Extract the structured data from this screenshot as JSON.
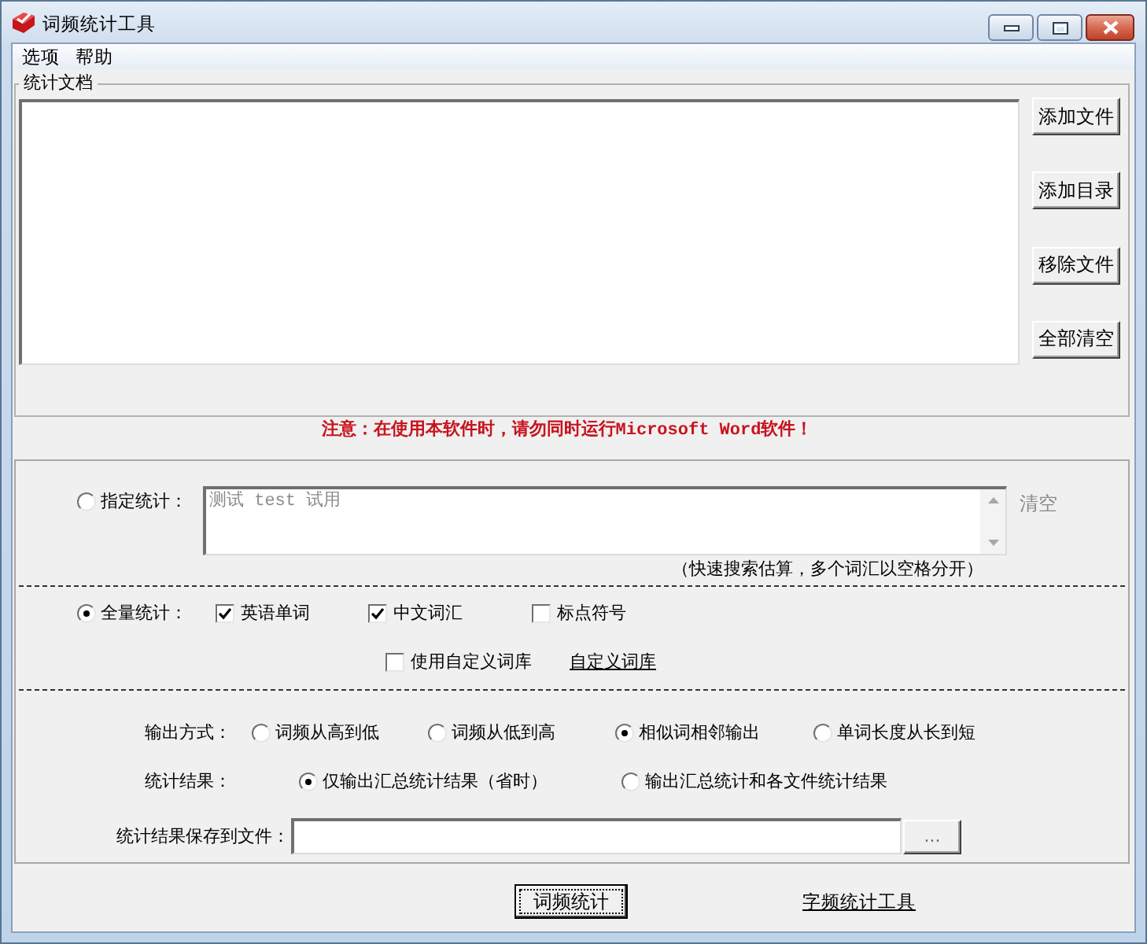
{
  "window": {
    "title": "词频统计工具"
  },
  "menu": [
    "选项",
    "帮助"
  ],
  "documents": {
    "legend": "统计文档",
    "buttons": [
      "添加文件",
      "添加目录",
      "移除文件",
      "全部清空"
    ]
  },
  "notice": "注意：在使用本软件时，请勿同时运行Microsoft Word软件！",
  "specified": {
    "label": "指定统计：",
    "selected": false,
    "field": {
      "value": "测试 test 试用",
      "disabled": true
    },
    "clear": {
      "label": "清空",
      "disabled": true
    },
    "hint": "（快速搜索估算，多个词汇以空格分开）"
  },
  "full": {
    "label": "全量统计：",
    "selected": true,
    "options": [
      {
        "label": "英语单词",
        "checked": true
      },
      {
        "label": "中文词汇",
        "checked": true
      },
      {
        "label": "标点符号",
        "checked": false
      }
    ],
    "custom_dictionary": {
      "label": "使用自定义词库",
      "checked": false
    },
    "dictionary_link": "自定义词库"
  },
  "output_mode": {
    "label": "输出方式：",
    "options": [
      {
        "label": "词频从高到低",
        "selected": false
      },
      {
        "label": "词频从低到高",
        "selected": false
      },
      {
        "label": "相似词相邻输出",
        "selected": true
      },
      {
        "label": "单词长度从长到短",
        "selected": false
      }
    ]
  },
  "result": {
    "label": "统计结果：",
    "options": [
      {
        "label": "仅输出汇总统计结果（省时）",
        "selected": true
      },
      {
        "label": "输出汇总统计和各文件统计结果",
        "selected": false
      }
    ]
  },
  "save": {
    "label": "统计结果保存到文件：",
    "browse": "..."
  },
  "actions": {
    "run": {
      "label": "词频统计",
      "focused": true
    },
    "link": "字频统计工具"
  }
}
